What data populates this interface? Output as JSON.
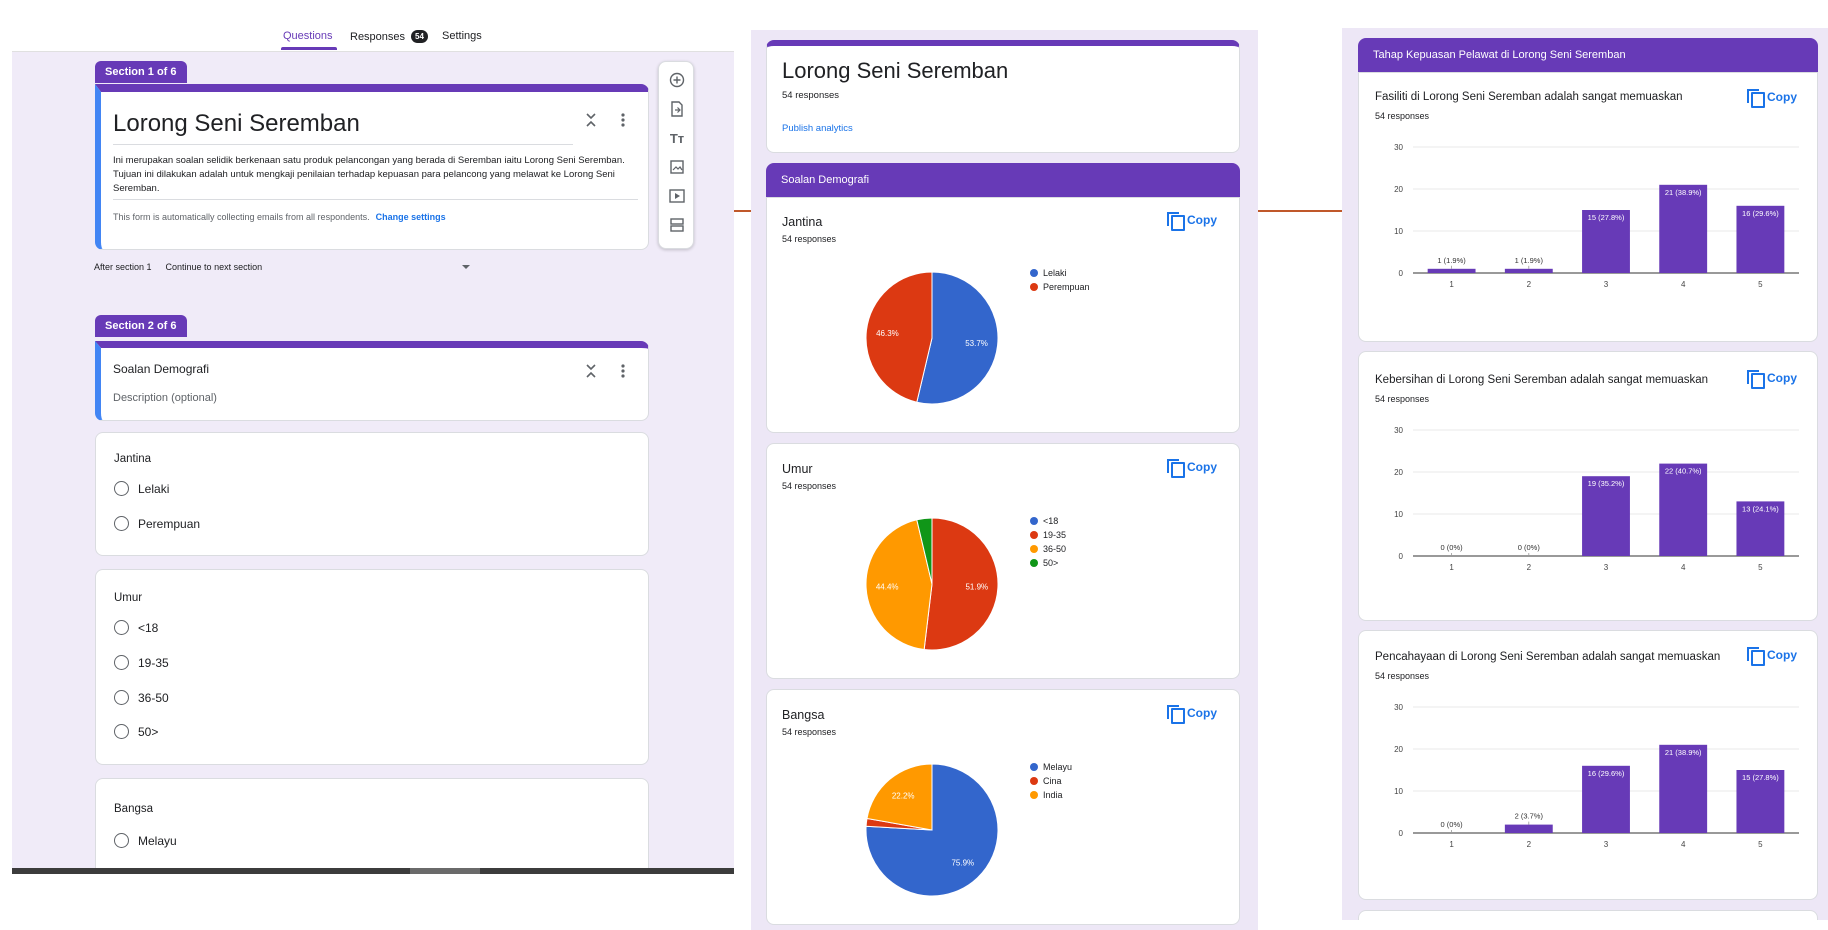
{
  "editor": {
    "tabs": {
      "questions": "Questions",
      "responses": "Responses",
      "responses_badge": "54",
      "settings": "Settings"
    },
    "section1": {
      "tag": "Section 1 of 6",
      "title": "Lorong Seni Seremban",
      "description": "Ini merupakan soalan selidik berkenaan satu produk pelancongan yang berada di Seremban iaitu Lorong Seni Seremban. Tujuan ini dilakukan adalah untuk mengkaji penilaian terhadap kepuasan para pelancong yang melawat ke Lorong Seni Seremban.",
      "email_note": "This form is automatically collecting emails from all respondents.",
      "change_settings": "Change settings"
    },
    "after_section": {
      "label": "After section 1",
      "value": "Continue to next section"
    },
    "section2": {
      "tag": "Section 2 of 6",
      "title": "Soalan Demografi",
      "description_placeholder": "Description (optional)"
    },
    "questions": [
      {
        "title": "Jantina",
        "options": [
          "Lelaki",
          "Perempuan"
        ]
      },
      {
        "title": "Umur",
        "options": [
          "<18",
          "19-35",
          "36-50",
          "50>"
        ]
      },
      {
        "title": "Bangsa",
        "options": [
          "Melayu"
        ]
      }
    ],
    "toolbar": [
      "add-question-icon",
      "import-questions-icon",
      "add-title-icon",
      "add-image-icon",
      "add-video-icon",
      "add-section-icon"
    ]
  },
  "summary": {
    "title": "Lorong Seni Seremban",
    "responses": "54 responses",
    "publish": "Publish analytics",
    "section_header": "Soalan Demografi",
    "copy_label": "Copy",
    "pies": [
      {
        "title": "Jantina",
        "responses": "54 responses",
        "chart_data": {
          "type": "pie",
          "labels": [
            "Lelaki",
            "Perempuan"
          ],
          "values": [
            53.7,
            46.3
          ],
          "value_labels": [
            "53.7%",
            "46.3%"
          ],
          "colors": [
            "#3366cc",
            "#dc3912"
          ]
        }
      },
      {
        "title": "Umur",
        "responses": "54 responses",
        "chart_data": {
          "type": "pie",
          "labels": [
            "<18",
            "19-35",
            "36-50",
            "50>"
          ],
          "values": [
            0,
            51.9,
            44.4,
            3.7
          ],
          "value_labels": [
            "",
            "51.9%",
            "44.4%",
            ""
          ],
          "colors": [
            "#3366cc",
            "#dc3912",
            "#ff9900",
            "#109618"
          ]
        }
      },
      {
        "title": "Bangsa",
        "responses": "54 responses",
        "chart_data": {
          "type": "pie",
          "labels": [
            "Melayu",
            "Cina",
            "India"
          ],
          "values": [
            75.9,
            1.9,
            22.2
          ],
          "value_labels": [
            "75.9%",
            "",
            "22.2%"
          ],
          "colors": [
            "#3366cc",
            "#dc3912",
            "#ff9900"
          ]
        }
      }
    ]
  },
  "satisfaction": {
    "section_header": "Tahap Kepuasan Pelawat di Lorong Seni Seremban",
    "copy_label": "Copy",
    "bars": [
      {
        "title": "Fasiliti di Lorong Seni Seremban adalah sangat memuaskan",
        "responses": "54 responses",
        "chart_data": {
          "type": "bar",
          "categories": [
            "1",
            "2",
            "3",
            "4",
            "5"
          ],
          "values": [
            1,
            1,
            15,
            21,
            16
          ],
          "labels": [
            "1 (1.9%)",
            "1 (1.9%)",
            "15 (27.8%)",
            "21 (38.9%)",
            "16 (29.6%)"
          ],
          "yticks": [
            "0",
            "10",
            "20",
            "30"
          ],
          "ylim": [
            0,
            30
          ]
        }
      },
      {
        "title": "Kebersihan di Lorong Seni Seremban adalah sangat memuaskan",
        "responses": "54 responses",
        "chart_data": {
          "type": "bar",
          "categories": [
            "1",
            "2",
            "3",
            "4",
            "5"
          ],
          "values": [
            0,
            0,
            19,
            22,
            13
          ],
          "labels": [
            "0 (0%)",
            "0 (0%)",
            "19 (35.2%)",
            "22 (40.7%)",
            "13 (24.1%)"
          ],
          "yticks": [
            "0",
            "10",
            "20",
            "30"
          ],
          "ylim": [
            0,
            30
          ]
        }
      },
      {
        "title": "Pencahayaan di Lorong Seni Seremban adalah sangat memuaskan",
        "responses": "54 responses",
        "chart_data": {
          "type": "bar",
          "categories": [
            "1",
            "2",
            "3",
            "4",
            "5"
          ],
          "values": [
            0,
            2,
            16,
            21,
            15
          ],
          "labels": [
            "0 (0%)",
            "2 (3.7%)",
            "16 (29.6%)",
            "21 (38.9%)",
            "15 (27.8%)"
          ],
          "yticks": [
            "0",
            "10",
            "20",
            "30"
          ],
          "ylim": [
            0,
            30
          ]
        }
      }
    ]
  }
}
